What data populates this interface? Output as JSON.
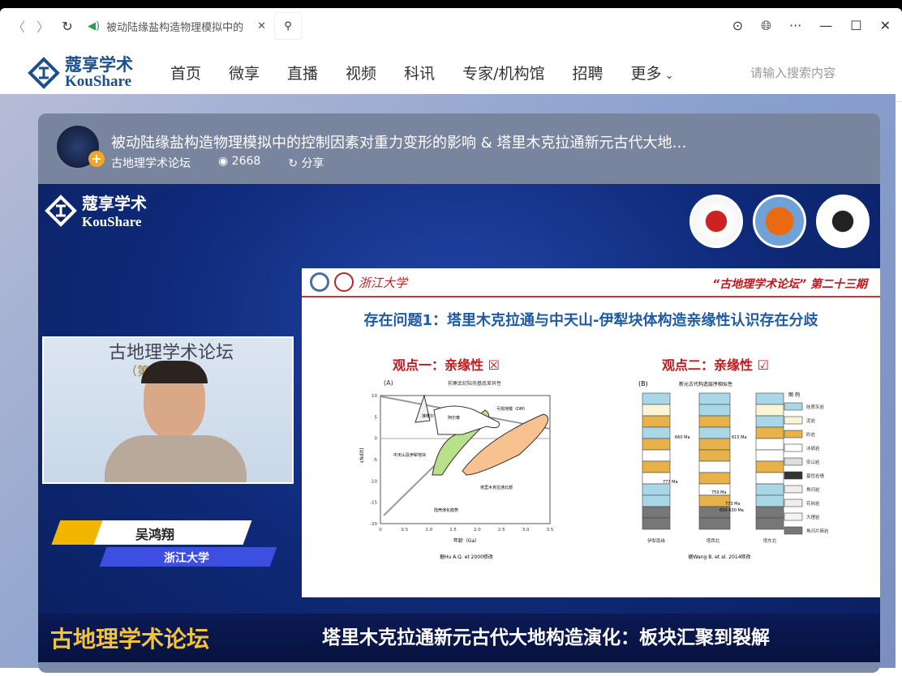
{
  "browser": {
    "tab_title": "被动陆缘盐构造物理模拟中的",
    "close": "✕",
    "icons": [
      "back-icon",
      "forward-icon",
      "reload-icon",
      "sound-icon",
      "search-icon",
      "download-icon",
      "globe-icon",
      "more-icon",
      "minimize-icon",
      "maximize-icon",
      "close-icon"
    ]
  },
  "site": {
    "logo_zh": "蔻享学术",
    "logo_en": "KouShare",
    "nav": [
      "首页",
      "微享",
      "直播",
      "视频",
      "科讯",
      "专家/机构馆",
      "招聘",
      "更多"
    ],
    "search_placeholder": "请输入搜索内容"
  },
  "video_info": {
    "title": "被动陆缘盐构造物理模拟中的控制因素对重力变形的影响 & 塔里木克拉通新元古代大地…",
    "channel": "古地理学术论坛",
    "views": "2668",
    "share": "分享"
  },
  "slide": {
    "header_right": "“古地理学术论坛” 第二十三期",
    "uni": "浙江大学",
    "title": "存在问题1：塔里木克拉通与中天山-伊犁块体构造亲缘性认识存在分歧",
    "view1": "观点一：亲缘性",
    "view2": "观点二：亲缘性",
    "view1_mark": "☒",
    "view2_mark": "☑"
  },
  "chart_data": [
    {
      "type": "area",
      "panel": "(A)",
      "title": "前寒武纪陆壳基底差异性",
      "xlabel": "年龄（Ga）",
      "ylabel": "εNd(t)",
      "xlim": [
        0,
        3.5
      ],
      "ylim": [
        -20,
        10
      ],
      "xticks": [
        "0",
        "0.5",
        "1.0",
        "1.5",
        "2.0",
        "2.5",
        "3.0",
        "3.5"
      ],
      "yticks": [
        "10",
        "5",
        "0",
        "-5",
        "-10",
        "-15",
        "-20"
      ],
      "regions": [
        "准噶尔",
        "阿尔泰",
        "中天山及伊犁地块",
        "塔里木克拉通北部"
      ],
      "annotations": [
        "亏损地幔（DM）",
        "陆壳演化趋势"
      ],
      "source": "据Hu A.Q. et 2000修改"
    },
    {
      "type": "table",
      "panel": "(B)",
      "title": "新元古代构造层序相似性",
      "columns": [
        "伊犁南缘",
        "塔西北",
        "塔东北"
      ],
      "ages": [
        "660 Ma",
        "615 Ma",
        "777 Ma",
        "759 Ma",
        "773 Ma",
        "650-630 Ma"
      ],
      "legend_title": "图 例",
      "legend": [
        "硅质灰岩",
        "泥岩",
        "砂岩",
        "冰碛岩",
        "安山岩",
        "基性岩墙",
        "角闪岩",
        "花岗岩",
        "大理岩",
        "角闪片麻岩"
      ],
      "legend_colors": [
        "#a8d8e8",
        "#fbf5d8",
        "#e8b24a",
        "#ffffff",
        "#dddddd",
        "#333333",
        "#eeeeee",
        "#eeeeee",
        "#f4f4f4",
        "#777777"
      ],
      "source": "据Wang B. et al.  2014修改"
    }
  ],
  "speaker": {
    "name": "吴鸿翔",
    "affiliation": "浙江大学",
    "bg_title": "古地理学术论坛",
    "bg_sub": "（第二十三期）"
  },
  "banner": {
    "left": "古地理学术论坛",
    "right": "塔里木克拉通新元古代大地构造演化：板块汇聚到裂解"
  }
}
